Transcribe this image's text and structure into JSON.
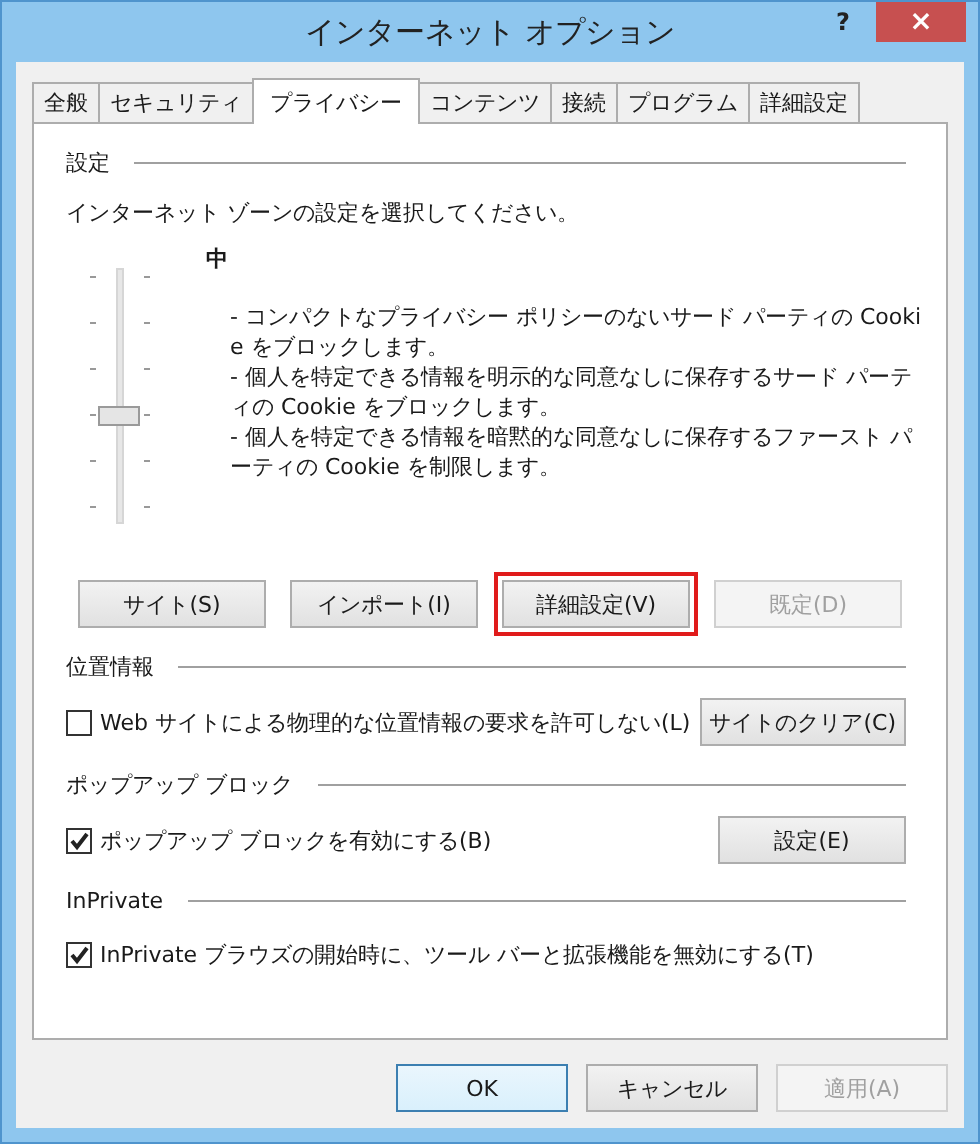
{
  "window": {
    "title": "インターネット オプション",
    "help": "?",
    "close": "×"
  },
  "tabs": [
    {
      "label": "全般",
      "selected": false
    },
    {
      "label": "セキュリティ",
      "selected": false
    },
    {
      "label": "プライバシー",
      "selected": true
    },
    {
      "label": "コンテンツ",
      "selected": false
    },
    {
      "label": "接続",
      "selected": false
    },
    {
      "label": "プログラム",
      "selected": false
    },
    {
      "label": "詳細設定",
      "selected": false
    }
  ],
  "settings": {
    "heading": "設定",
    "instruction": "インターネット ゾーンの設定を選択してください。",
    "slider": {
      "level": 0.4
    },
    "level_name": "中",
    "description": [
      "- コンパクトなプライバシー ポリシーのないサード パーティの Cookie をブロックします。",
      "- 個人を特定できる情報を明示的な同意なしに保存するサード パーティの Cookie をブロックします。",
      "- 個人を特定できる情報を暗黙的な同意なしに保存するファースト パーティの Cookie を制限します。"
    ],
    "buttons": [
      {
        "label": "サイト(S)",
        "disabled": false,
        "highlighted": false
      },
      {
        "label": "インポート(I)",
        "disabled": false,
        "highlighted": false
      },
      {
        "label": "詳細設定(V)",
        "disabled": false,
        "highlighted": true
      },
      {
        "label": "既定(D)",
        "disabled": true,
        "highlighted": false
      }
    ]
  },
  "sections": [
    {
      "heading": "位置情報",
      "checkbox": {
        "label": "Web サイトによる物理的な位置情報の要求を許可しない(L)",
        "checked": false
      },
      "button": {
        "label": "サイトのクリア(C)"
      }
    },
    {
      "heading": "ポップアップ ブロック",
      "checkbox": {
        "label": "ポップアップ ブロックを有効にする(B)",
        "checked": true
      },
      "button": {
        "label": "設定(E)"
      }
    },
    {
      "heading": "InPrivate",
      "checkbox": {
        "label": "InPrivate ブラウズの開始時に、ツール バーと拡張機能を無効にする(T)",
        "checked": true
      }
    }
  ],
  "footer_buttons": [
    {
      "label": "OK",
      "default": true,
      "disabled": false
    },
    {
      "label": "キャンセル",
      "default": false,
      "disabled": false
    },
    {
      "label": "適用(A)",
      "default": false,
      "disabled": true
    }
  ]
}
